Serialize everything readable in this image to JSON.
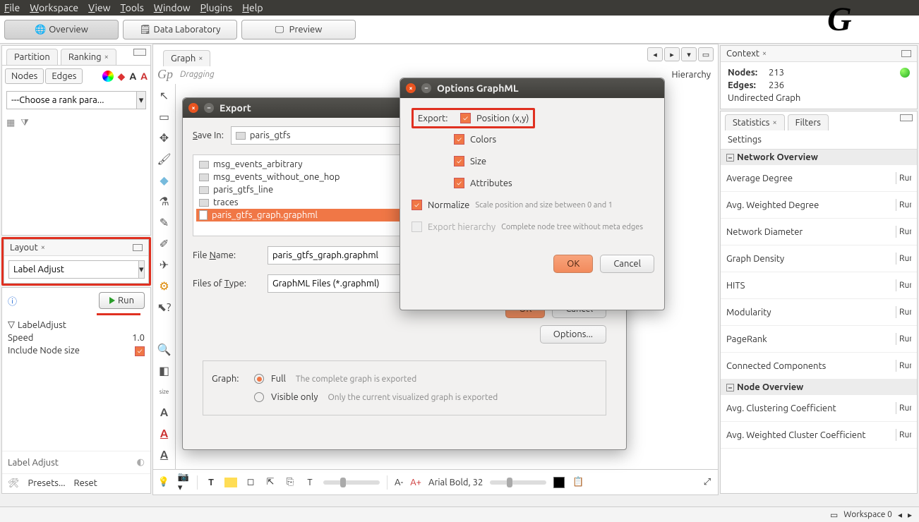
{
  "menu": {
    "file": "File",
    "workspace": "Workspace",
    "view": "View",
    "tools": "Tools",
    "window": "Window",
    "plugins": "Plugins",
    "help": "Help"
  },
  "top": {
    "overview": "Overview",
    "datalab": "Data Laboratory",
    "preview": "Preview"
  },
  "ranking": {
    "tab_partition": "Partition",
    "tab_ranking": "Ranking",
    "nodes": "Nodes",
    "edges": "Edges",
    "placeholder": "---Choose a rank para..."
  },
  "layout": {
    "title": "Layout",
    "selected": "Label Adjust",
    "run": "Run",
    "group": "LabelAdjust",
    "speed_label": "Speed",
    "speed_value": "1.0",
    "include_label": "Include Node size",
    "footer": "Label Adjust",
    "presets": "Presets...",
    "reset": "Reset"
  },
  "graph": {
    "tab": "Graph",
    "mode": "Dragging",
    "hierarchy": "Hierarchy"
  },
  "bottom": {
    "font": "Arial Bold, 32",
    "aminus": "A-",
    "aplus": "A+",
    "tbold": "T"
  },
  "export": {
    "title": "Export",
    "savein_label": "Save In:",
    "savein_value": "paris_gtfs",
    "files": [
      "msg_events_arbitrary",
      "msg_events_without_one_hop",
      "paris_gtfs_line",
      "traces"
    ],
    "sel_file": "paris_gtfs_graph.graphml",
    "filename_label": "File Name:",
    "filename_value": "paris_gtfs_graph.graphml",
    "filetype_label": "Files of Type:",
    "filetype_value": "GraphML Files (*.graphml)",
    "ok": "OK",
    "cancel": "Cancel",
    "options": "Options...",
    "graph_label": "Graph:",
    "full": "Full",
    "full_desc": "The complete graph is exported",
    "visible": "Visible only",
    "visible_desc": "Only the current visualized graph is exported"
  },
  "opts": {
    "title": "Options GraphML",
    "export_label": "Export:",
    "position": "Position (x,y)",
    "colors": "Colors",
    "size": "Size",
    "attributes": "Attributes",
    "normalize": "Normalize",
    "normalize_desc": "Scale position and size between 0 and 1",
    "hierarchy": "Export hierarchy",
    "hierarchy_desc": "Complete node tree without meta edges",
    "ok": "OK",
    "cancel": "Cancel"
  },
  "context": {
    "title": "Context",
    "nodes_label": "Nodes:",
    "nodes": "213",
    "edges_label": "Edges:",
    "edges": "236",
    "type": "Undirected Graph"
  },
  "stats": {
    "tab_stats": "Statistics",
    "tab_filters": "Filters",
    "settings": "Settings",
    "hdr_net": "Network Overview",
    "hdr_node": "Node Overview",
    "run": "Run",
    "items": [
      "Average Degree",
      "Avg. Weighted Degree",
      "Network Diameter",
      "Graph Density",
      "HITS",
      "Modularity",
      "PageRank",
      "Connected Components"
    ],
    "node_items": [
      "Avg. Clustering Coefficient",
      "Avg. Weighted Cluster Coefficient"
    ]
  },
  "status": {
    "workspace": "Workspace 0"
  }
}
